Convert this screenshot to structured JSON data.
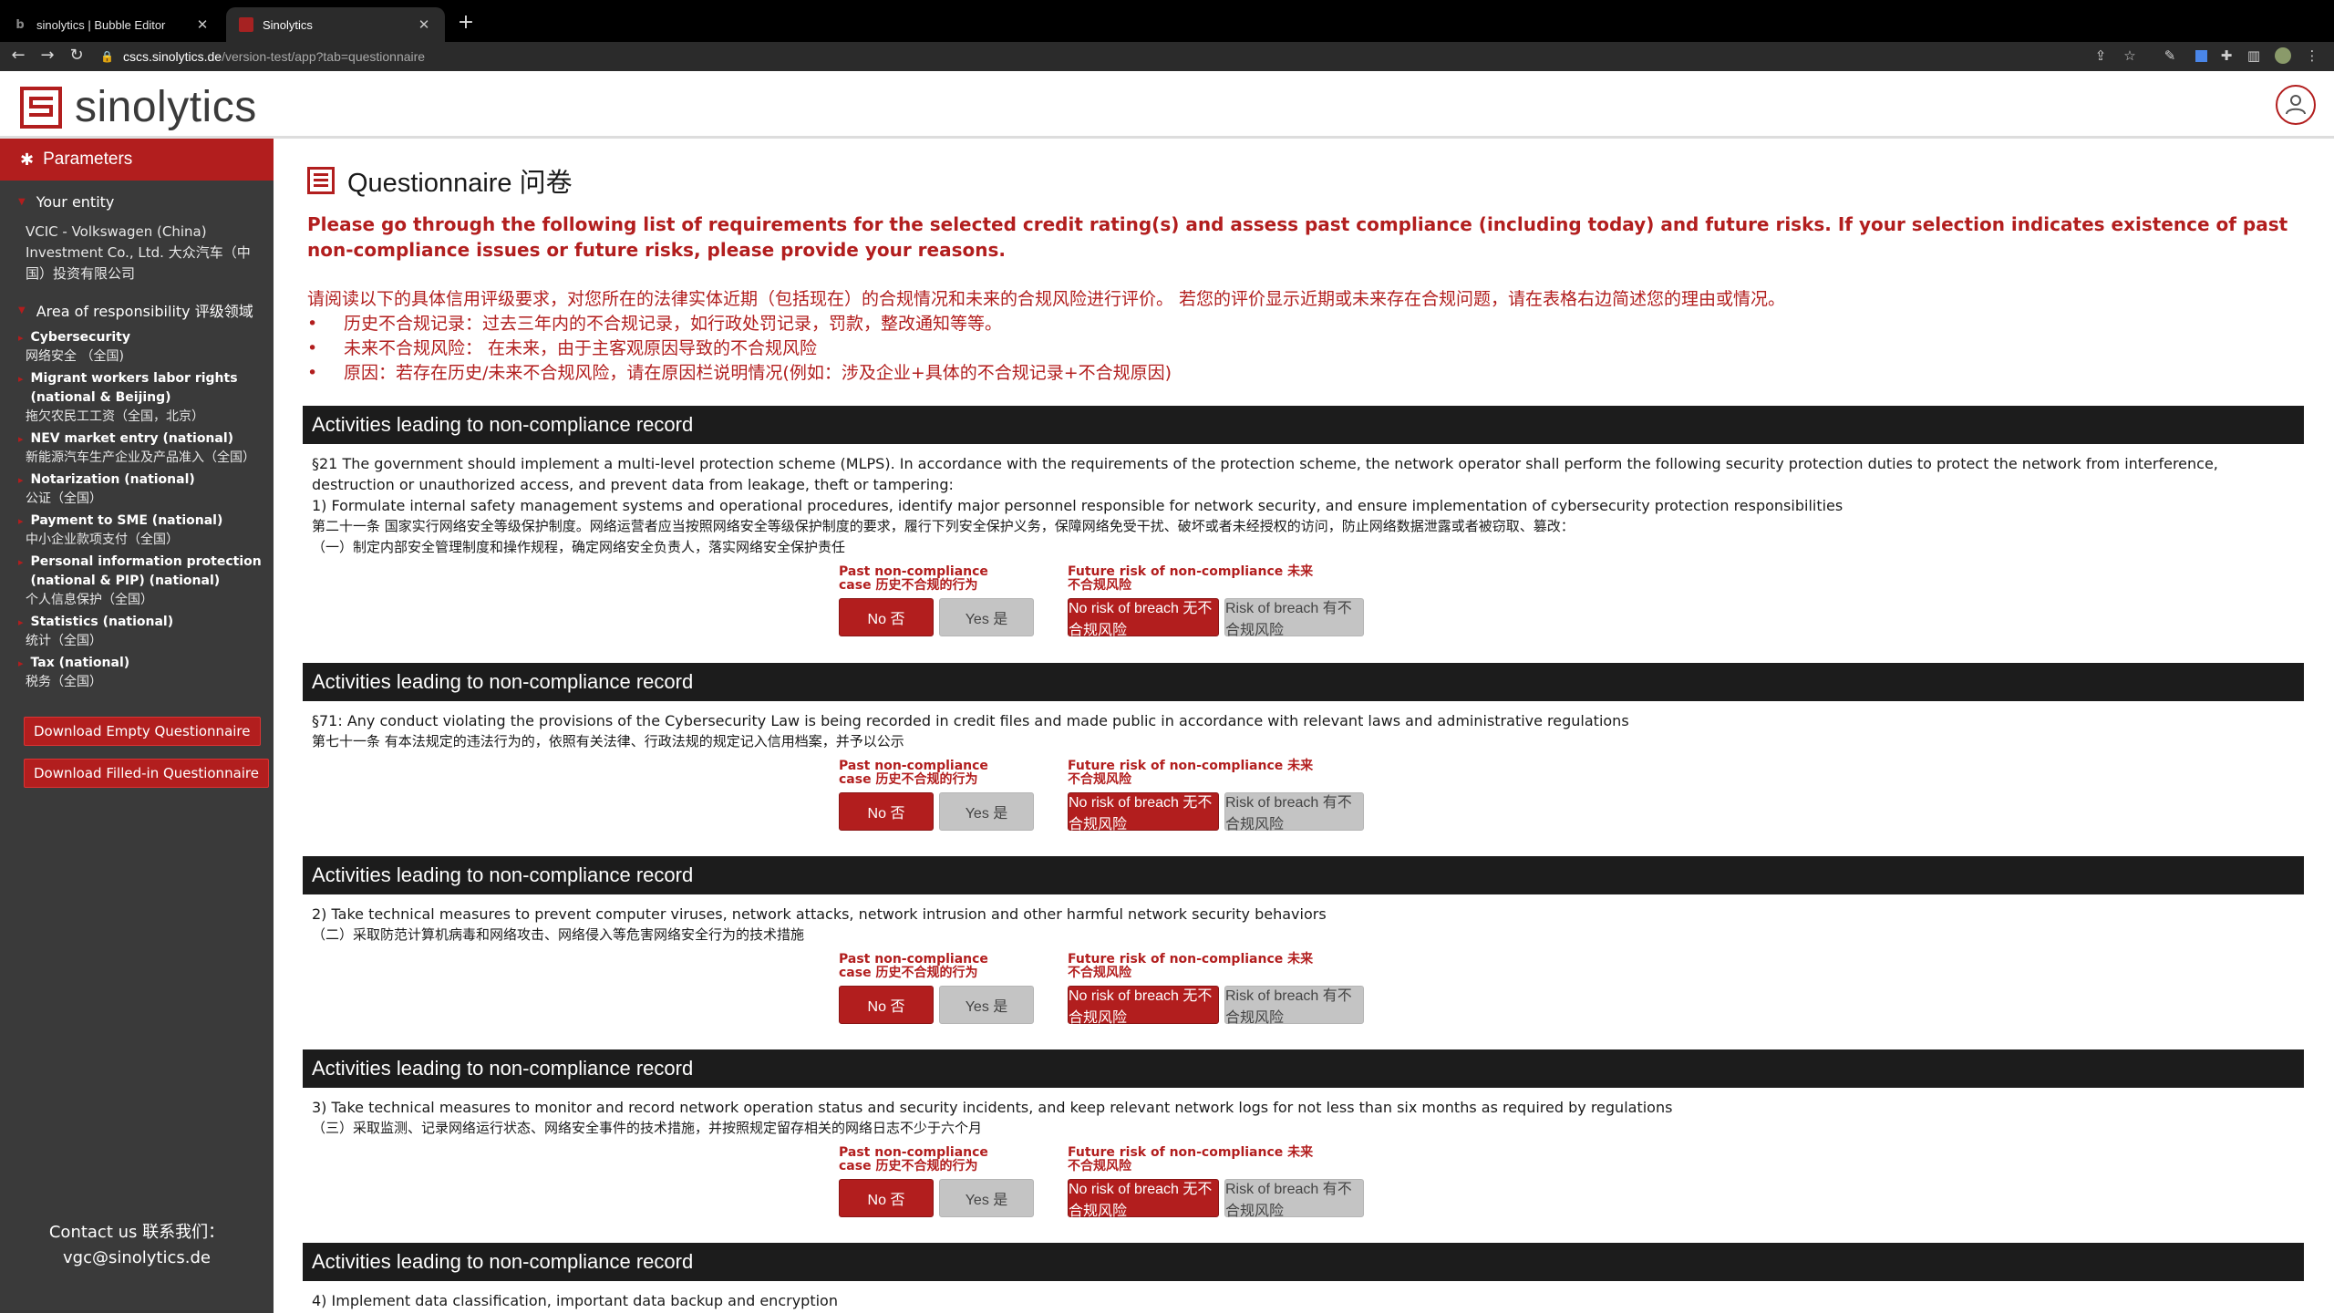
{
  "browser": {
    "tabs": [
      {
        "title": "sinolytics | Bubble Editor",
        "active": false
      },
      {
        "title": "Sinolytics",
        "active": true
      }
    ],
    "url_host": "cscs.sinolytics.de",
    "url_path": "/version-test/app?tab=questionnaire"
  },
  "header": {
    "logo_text": "sinolytics",
    "accent": "#b21e1e"
  },
  "sidebar": {
    "parameters_label": "Parameters",
    "entity_label": "Your entity",
    "entity_value": "VCIC - Volkswagen (China) Investment Co., Ltd. 大众汽车（中国）投资有限公司",
    "area_label": "Area of responsibility 评级领域",
    "areas": [
      {
        "en": "Cybersecurity",
        "zh": "网络安全 （全国)"
      },
      {
        "en": "Migrant workers labor rights (national & Beijing)",
        "zh": "拖欠农民工工资（全国，北京）"
      },
      {
        "en": "NEV market entry (national)",
        "zh": "新能源汽车生产企业及产品准入（全国）"
      },
      {
        "en": "Notarization (national)",
        "zh": "公证（全国）"
      },
      {
        "en": "Payment to SME (national)",
        "zh": "中小企业款项支付（全国）"
      },
      {
        "en": "Personal information protection (national & PIP) (national)",
        "zh": "个人信息保护（全国）"
      },
      {
        "en": "Statistics (national)",
        "zh": "统计（全国）"
      },
      {
        "en": "Tax (national)",
        "zh": "税务（全国）"
      }
    ],
    "download_empty": "Download Empty Questionnaire",
    "download_filled": "Download Filled-in Questionnaire",
    "contact_label": "Contact us 联系我们：",
    "contact_email": "vgc@sinolytics.de"
  },
  "main": {
    "title": "Questionnaire 问卷",
    "intro_en": "Please go through the following list of requirements for the selected credit rating(s) and assess past compliance (including today) and future risks. If your selection indicates existence of past non-compliance issues or future risks, please provide your reasons.",
    "intro_zh": "请阅读以下的具体信用评级要求，对您所在的法律实体近期（包括现在）的合规情况和未来的合规风险进行评价。 若您的评价显示近期或未来存在合规问题，请在表格右边简述您的理由或情况。",
    "intro_bullets": [
      "历史不合规记录：过去三年内的不合规记录，如行政处罚记录，罚款，整改通知等等。",
      "未来不合规风险： 在未来，由于主客观原因导致的不合规风险",
      "原因：若存在历史/未来不合规风险，请在原因栏说明情况(例如：涉及企业+具体的不合规记录+不合规原因)"
    ],
    "answer_labels": {
      "past_line1": "Past non-compliance",
      "past_line2": "case 历史不合规的行为",
      "future_line1": "Future risk of non-compliance 未来",
      "future_line2": "不合规风险",
      "no": "No 否",
      "yes": "Yes 是",
      "no_risk": "No risk of breach 无不合规风险",
      "risk": "Risk of breach 有不合规风险"
    },
    "blocks": [
      {
        "header": "Activities leading to non-compliance record",
        "lines": [
          "§21 The government should implement a multi-level protection scheme (MLPS). In accordance with the requirements of the protection scheme, the network operator shall perform the following security protection duties to protect the network from interference, destruction or unauthorized access, and prevent data from leakage, theft or tampering:",
          "1) Formulate internal safety management systems and operational procedures, identify major personnel responsible for network security, and ensure implementation of cybersecurity protection responsibilities",
          "第二十一条 国家实行网络安全等级保护制度。网络运营者应当按照网络安全等级保护制度的要求，履行下列安全保护义务，保障网络免受干扰、破坏或者未经授权的访问，防止网络数据泄露或者被窃取、篡改：",
          "（一）制定内部安全管理制度和操作规程，确定网络安全负责人，落实网络安全保护责任"
        ]
      },
      {
        "header": "Activities leading to non-compliance record",
        "lines": [
          "§71: Any conduct violating the provisions of the Cybersecurity Law is being recorded in credit files and made public in accordance with relevant laws and administrative regulations",
          "第七十一条 有本法规定的违法行为的，依照有关法律、行政法规的规定记入信用档案，并予以公示"
        ]
      },
      {
        "header": "Activities leading to non-compliance record",
        "lines": [
          "2) Take technical measures to prevent computer viruses, network attacks, network intrusion and other harmful network security behaviors",
          "（二）采取防范计算机病毒和网络攻击、网络侵入等危害网络安全行为的技术措施"
        ]
      },
      {
        "header": "Activities leading to non-compliance record",
        "lines": [
          "3) Take technical measures to monitor and record network operation status and security incidents, and keep relevant network logs for not less than six months as required by regulations",
          "（三）采取监测、记录网络运行状态、网络安全事件的技术措施，并按照规定留存相关的网络日志不少于六个月"
        ]
      },
      {
        "header": "Activities leading to non-compliance record",
        "lines": [
          "4) Implement data classification, important data backup and encryption"
        ]
      }
    ]
  }
}
